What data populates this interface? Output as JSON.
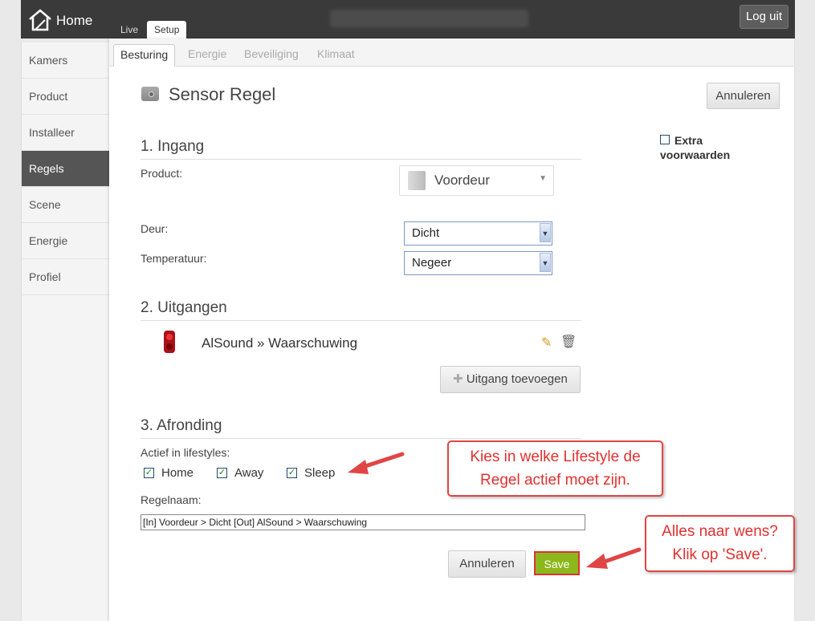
{
  "topbar": {
    "home_label": "Home",
    "logout_label": "Log uit",
    "tabs": [
      {
        "label": "Live"
      },
      {
        "label": "Setup"
      }
    ]
  },
  "sidebar": {
    "items": [
      {
        "label": "Kamers"
      },
      {
        "label": "Product"
      },
      {
        "label": "Installeer"
      },
      {
        "label": "Regels"
      },
      {
        "label": "Scene"
      },
      {
        "label": "Energie"
      },
      {
        "label": "Profiel"
      }
    ],
    "active_index": 3
  },
  "subtabs": [
    {
      "label": "Besturing"
    },
    {
      "label": "Energie"
    },
    {
      "label": "Beveiliging"
    },
    {
      "label": "Klimaat"
    }
  ],
  "page": {
    "title": "Sensor Regel",
    "cancel_top": "Annuleren",
    "extra_label_1": "Extra",
    "extra_label_2": "voorwaarden",
    "section1": {
      "heading": "1. Ingang",
      "product_label": "Product:",
      "product_value": "Voordeur",
      "door_label": "Deur:",
      "door_value": "Dicht",
      "temp_label": "Temperatuur:",
      "temp_value": "Negeer"
    },
    "section2": {
      "heading": "2. Uitgangen",
      "output_text": "AlSound » Waarschuwing",
      "add_output_label": "Uitgang toevoegen"
    },
    "section3": {
      "heading": "3. Afronding",
      "lifestyles_label": "Actief in lifestyles:",
      "lifestyles": [
        {
          "label": "Home",
          "checked": true
        },
        {
          "label": "Away",
          "checked": true
        },
        {
          "label": "Sleep",
          "checked": true
        }
      ],
      "rulename_label": "Regelnaam:",
      "rulename_value": "[In] Voordeur > Dicht  [Out] AlSound > Waarschuwing"
    },
    "cancel_bottom": "Annuleren",
    "save_label": "Save"
  },
  "annotations": {
    "lifestyle_line1": "Kies in welke Lifestyle de",
    "lifestyle_line2": "Regel actief moet zijn.",
    "save_line1": "Alles naar wens?",
    "save_line2": "Klik op 'Save'."
  },
  "colors": {
    "accent_red": "#e04545",
    "save_green": "#8cb81c"
  }
}
